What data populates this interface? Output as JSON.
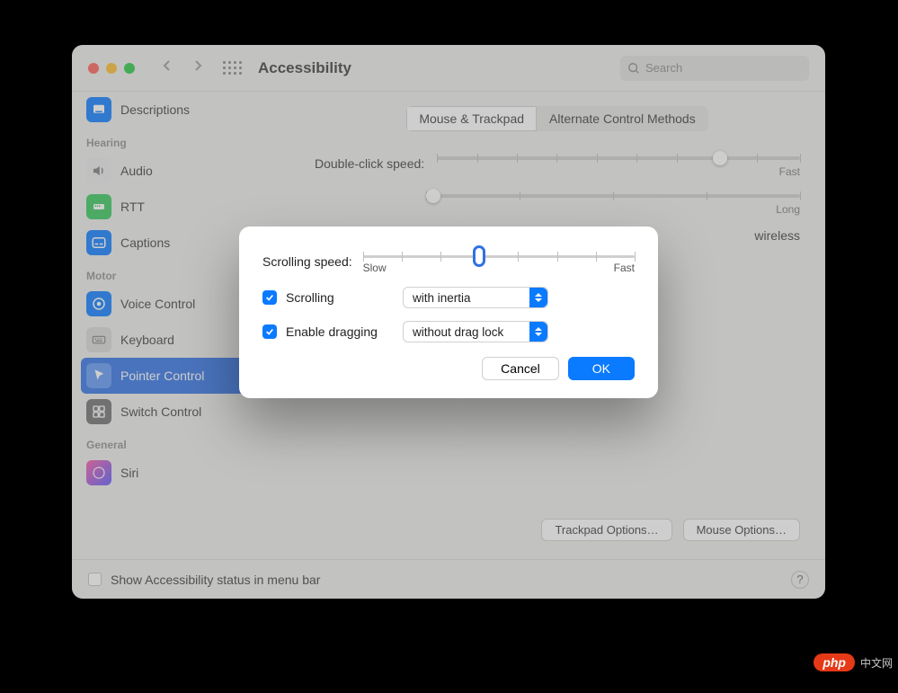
{
  "window": {
    "title": "Accessibility",
    "search_placeholder": "Search"
  },
  "sidebar": {
    "sections": [
      {
        "header": "",
        "items": [
          {
            "label": "Descriptions",
            "color": "#0a7aff"
          }
        ]
      },
      {
        "header": "Hearing",
        "items": [
          {
            "label": "Audio",
            "color": "#8e8e8e"
          },
          {
            "label": "RTT",
            "color": "#34c759"
          },
          {
            "label": "Captions",
            "color": "#0a7aff"
          }
        ]
      },
      {
        "header": "Motor",
        "items": [
          {
            "label": "Voice Control",
            "color": "#0a7aff"
          },
          {
            "label": "Keyboard",
            "color": "#8e8e8e"
          },
          {
            "label": "Pointer Control",
            "color": "#4a86f7",
            "selected": true
          },
          {
            "label": "Switch Control",
            "color": "#6e6e6e"
          }
        ]
      },
      {
        "header": "General",
        "items": [
          {
            "label": "Siri",
            "color": "linear"
          }
        ]
      }
    ]
  },
  "main": {
    "tabs": {
      "active": "Mouse & Trackpad",
      "other": "Alternate Control Methods"
    },
    "double_click_label": "Double-click speed:",
    "slider_end_fast": "Fast",
    "slider_end_long": "Long",
    "wireless": "wireless",
    "trackpad_options": "Trackpad Options…",
    "mouse_options": "Mouse Options…"
  },
  "footer": {
    "checkbox_label": "Show Accessibility status in menu bar",
    "help": "?"
  },
  "sheet": {
    "scrolling_speed_label": "Scrolling speed:",
    "slow": "Slow",
    "fast": "Fast",
    "scrolling_label": "Scrolling",
    "scrolling_mode": "with inertia",
    "dragging_label": "Enable dragging",
    "dragging_mode": "without drag lock",
    "cancel": "Cancel",
    "ok": "OK"
  },
  "watermark": {
    "badge": "php",
    "text": "中文网"
  }
}
